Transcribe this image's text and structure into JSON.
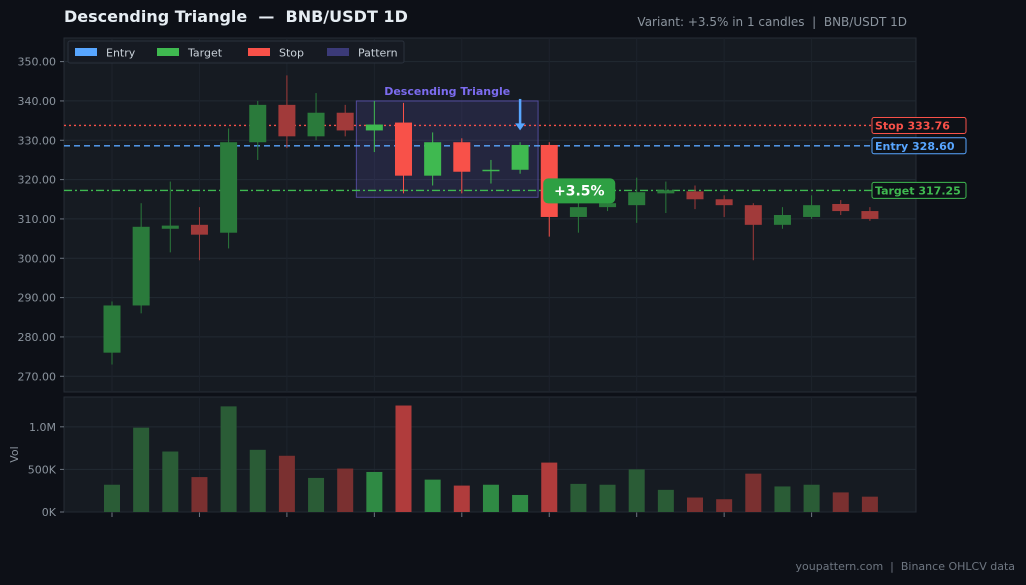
{
  "header": {
    "title": "Descending Triangle  —  BNB/USDT 1D",
    "subtitle": "Variant: +3.5% in 1 candles  |  BNB/USDT 1D"
  },
  "footer": {
    "text": "youpattern.com  |  Binance OHLCV data"
  },
  "chart_data": {
    "type": "candlestick",
    "price_axis": {
      "ylim": [
        266,
        356
      ],
      "ticks": [
        270,
        280,
        290,
        300,
        310,
        320,
        330,
        340,
        350
      ],
      "tick_labels": [
        "270.00",
        "280.00",
        "290.00",
        "300.00",
        "310.00",
        "320.00",
        "330.00",
        "340.00",
        "350.00"
      ]
    },
    "volume_axis": {
      "label": "Vol",
      "ylim": [
        0,
        1350000
      ],
      "ticks": [
        0,
        500000,
        1000000
      ],
      "tick_labels": [
        "0K",
        "500K",
        "1.0M"
      ]
    },
    "candles": [
      {
        "o": 276.0,
        "h": 289.0,
        "l": 273.0,
        "c": 288.0,
        "v": 320000
      },
      {
        "o": 288.0,
        "h": 314.0,
        "l": 286.0,
        "c": 308.0,
        "v": 990000
      },
      {
        "o": 307.5,
        "h": 319.5,
        "l": 301.5,
        "c": 308.3,
        "v": 710000
      },
      {
        "o": 308.5,
        "h": 313.0,
        "l": 299.5,
        "c": 306.0,
        "v": 410000
      },
      {
        "o": 306.5,
        "h": 333.0,
        "l": 302.5,
        "c": 329.5,
        "v": 1240000
      },
      {
        "o": 329.5,
        "h": 340.0,
        "l": 325.0,
        "c": 339.0,
        "v": 730000
      },
      {
        "o": 339.0,
        "h": 346.5,
        "l": 328.0,
        "c": 331.0,
        "v": 660000
      },
      {
        "o": 331.0,
        "h": 342.0,
        "l": 330.0,
        "c": 337.0,
        "v": 400000
      },
      {
        "o": 337.0,
        "h": 339.0,
        "l": 331.0,
        "c": 332.5,
        "v": 510000
      },
      {
        "o": 332.5,
        "h": 340.0,
        "l": 327.0,
        "c": 334.0,
        "v": 470000
      },
      {
        "o": 334.5,
        "h": 339.5,
        "l": 316.5,
        "c": 321.0,
        "v": 1250000
      },
      {
        "o": 321.0,
        "h": 332.0,
        "l": 318.5,
        "c": 329.5,
        "v": 380000
      },
      {
        "o": 329.5,
        "h": 330.5,
        "l": 316.5,
        "c": 322.0,
        "v": 310000
      },
      {
        "o": 322.3,
        "h": 325.0,
        "l": 319.0,
        "c": 322.5,
        "v": 320000
      },
      {
        "o": 322.5,
        "h": 329.5,
        "l": 321.5,
        "c": 328.8,
        "v": 200000
      },
      {
        "o": 328.8,
        "h": 329.5,
        "l": 305.5,
        "c": 310.5,
        "v": 580000
      },
      {
        "o": 310.5,
        "h": 314.5,
        "l": 306.5,
        "c": 313.0,
        "v": 330000
      },
      {
        "o": 313.0,
        "h": 315.5,
        "l": 312.0,
        "c": 314.0,
        "v": 320000
      },
      {
        "o": 313.5,
        "h": 320.5,
        "l": 309.0,
        "c": 316.8,
        "v": 500000
      },
      {
        "o": 316.5,
        "h": 319.5,
        "l": 311.5,
        "c": 317.3,
        "v": 260000
      },
      {
        "o": 317.0,
        "h": 318.5,
        "l": 312.5,
        "c": 315.0,
        "v": 170000
      },
      {
        "o": 315.0,
        "h": 316.0,
        "l": 310.5,
        "c": 313.5,
        "v": 150000
      },
      {
        "o": 313.5,
        "h": 314.0,
        "l": 299.5,
        "c": 308.5,
        "v": 450000
      },
      {
        "o": 308.5,
        "h": 313.0,
        "l": 307.5,
        "c": 311.0,
        "v": 300000
      },
      {
        "o": 310.5,
        "h": 316.0,
        "l": 310.0,
        "c": 313.5,
        "v": 320000
      },
      {
        "o": 313.8,
        "h": 314.8,
        "l": 311.0,
        "c": 312.0,
        "v": 230000
      },
      {
        "o": 312.0,
        "h": 313.0,
        "l": 309.5,
        "c": 310.0,
        "v": 180000
      }
    ],
    "levels": [
      {
        "name": "Stop",
        "value": 333.76,
        "label": "Stop  333.76",
        "color": "#f85149",
        "style": "dotted"
      },
      {
        "name": "Entry",
        "value": 328.6,
        "label": "Entry  328.60",
        "color": "#58a6ff",
        "style": "dashed"
      },
      {
        "name": "Target",
        "value": 317.25,
        "label": "Target  317.25",
        "color": "#3fb950",
        "style": "dashdot"
      }
    ],
    "pattern": {
      "label": "Descending Triangle",
      "start_index": 9,
      "end_index": 14,
      "price_low": 315.5,
      "price_high": 340.0,
      "color": "#7c6cf0"
    },
    "entry_arrow_index": 14,
    "result_badge": {
      "text": "+3.5%",
      "index": 15,
      "price": 317.25
    },
    "legend": [
      {
        "label": "Entry",
        "color": "#58a6ff"
      },
      {
        "label": "Target",
        "color": "#3fb950"
      },
      {
        "label": "Stop",
        "color": "#f85149"
      },
      {
        "label": "Pattern",
        "color": "#3b3a78"
      }
    ],
    "colors": {
      "up": "#3fb950",
      "down": "#f85149",
      "up_dim": "#2a7a3b",
      "down_dim": "#a13a3a",
      "up_vol": "#2a5c36",
      "down_vol": "#7a3030",
      "up_vol_bright": "#2f8a44",
      "down_vol_bright": "#b03c3c"
    }
  }
}
